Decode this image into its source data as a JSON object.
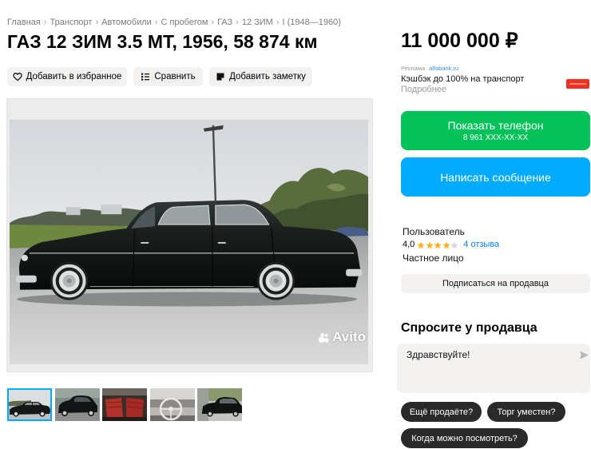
{
  "breadcrumb": {
    "separator": "›",
    "items": [
      "Главная",
      "Транспорт",
      "Автомобили",
      "С пробегом",
      "ГАЗ",
      "12 ЗИМ",
      "I (1948—1960)"
    ]
  },
  "listing": {
    "title": "ГАЗ 12 ЗИМ 3.5 MT, 1956, 58 874 км"
  },
  "actions": {
    "favorite": {
      "label": "Добавить в избранное",
      "icon": "heart-icon"
    },
    "compare": {
      "label": "Сравнить",
      "icon": "compare-list-icon"
    },
    "note": {
      "label": "Добавить заметку",
      "icon": "note-icon"
    }
  },
  "photo": {
    "subject": "black-sedan-side-view",
    "watermark": "Avito"
  },
  "gallery": {
    "selected_index": 0,
    "thumbnails": [
      {
        "icon": "car-side-thumbnail"
      },
      {
        "icon": "car-rear-thumbnail"
      },
      {
        "icon": "interior-seats-thumbnail"
      },
      {
        "icon": "dashboard-steering-wheel-thumbnail"
      },
      {
        "icon": "car-side-dark-thumbnail"
      }
    ]
  },
  "price": "11 000 000 ₽",
  "ad": {
    "label": "Реклама",
    "domain": "alfabank.ru",
    "text": "Кэшбэк до 100% на транспорт",
    "more": "Подробнее"
  },
  "contact": {
    "show_phone": "Показать телефон",
    "phone_masked": "8 961 XXX-XX-XX",
    "write_message": "Написать сообщение"
  },
  "seller": {
    "name": "Пользователь",
    "rating": "4,0",
    "stars_filled": 4,
    "stars_total": 5,
    "reviews": "4 отзыва",
    "type": "Частное лицо",
    "subscribe": "Подписаться на продавца"
  },
  "ask": {
    "heading": "Спросите у продавца",
    "message": "Здравствуйте!",
    "quick_replies": [
      "Ещё продаёте?",
      "Торг уместен?",
      "Когда можно посмотреть?"
    ]
  },
  "colors": {
    "green": "#04c25a",
    "blue": "#00aaff",
    "star": "#ffb021",
    "link": "#0a7ff5",
    "ad_logo": "#ef3124"
  }
}
